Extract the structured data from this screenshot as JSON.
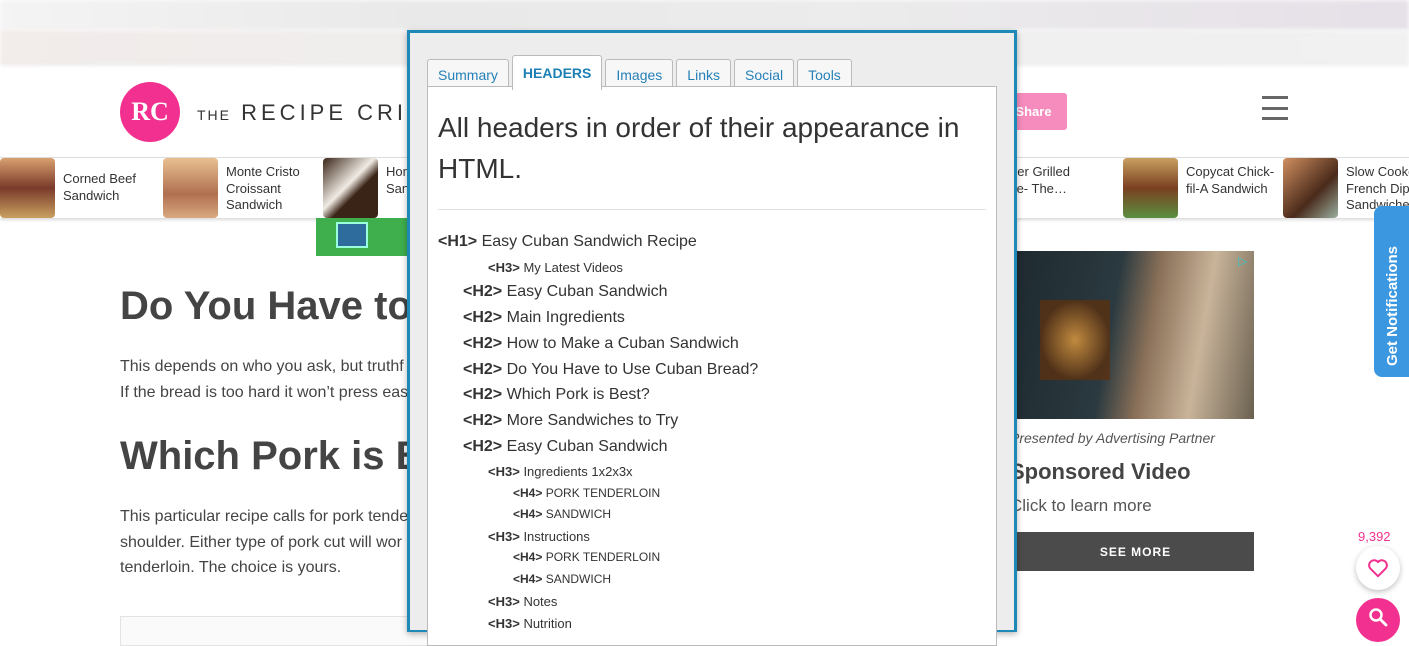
{
  "site": {
    "logo_text": "RC",
    "brand": "THE RECIPE CRITIC",
    "brand_the": "THE",
    "brand_name": "RECIPE CRITIC",
    "brand_sep": "/",
    "share_label": "Share",
    "accent": "#f2308f"
  },
  "related": [
    {
      "title": "Corned Beef Sandwich"
    },
    {
      "title": "Monte Cristo Croissant Sandwich"
    },
    {
      "title": "Hom… Ice … San…"
    },
    {
      "title": "Air Fryer Grilled Cheese- The…"
    },
    {
      "title": "Copycat Chick-fil-A Sandwich"
    },
    {
      "title": "Slow Cooker French Dip Sandwiches"
    }
  ],
  "article": {
    "h2_1": "Do You Have to Use Cuban Bread?",
    "p1_l1": "This depends on who you ask, but truthf",
    "p1_l2": "If the bread is too hard it won’t press eas",
    "h2_2": "Which Pork is Best?",
    "p2_l1": "This particular recipe calls for pork tende",
    "p2_l2": "shoulder. Either type of pork cut will wor",
    "p2_l3": "tenderloin. The choice is yours."
  },
  "sidebar_ad": {
    "partner": "Presented by Advertising Partner",
    "title": "Sponsored Video",
    "learn": "Click to learn more",
    "see_more": "SEE MORE"
  },
  "notifications_label": "Get Notifications",
  "favorites_count": "9,392",
  "panel": {
    "tabs": [
      {
        "label": "Summary",
        "active": false
      },
      {
        "label": "HEADERS",
        "active": true
      },
      {
        "label": "Images",
        "active": false
      },
      {
        "label": "Links",
        "active": false
      },
      {
        "label": "Social",
        "active": false
      },
      {
        "label": "Tools",
        "active": false
      }
    ],
    "title": "All headers in order of their appearance in HTML.",
    "headers": [
      {
        "tag": "<H1>",
        "level": 1,
        "text": "Easy Cuban Sandwich Recipe"
      },
      {
        "tag": "<H3>",
        "level": 3,
        "text": "My Latest Videos"
      },
      {
        "tag": "<H2>",
        "level": 2,
        "text": "Easy Cuban Sandwich"
      },
      {
        "tag": "<H2>",
        "level": 2,
        "text": "Main Ingredients"
      },
      {
        "tag": "<H2>",
        "level": 2,
        "text": "How to Make a Cuban Sandwich"
      },
      {
        "tag": "<H2>",
        "level": 2,
        "text": "Do You Have to Use Cuban Bread?"
      },
      {
        "tag": "<H2>",
        "level": 2,
        "text": "Which Pork is Best?"
      },
      {
        "tag": "<H2>",
        "level": 2,
        "text": "More Sandwiches to Try"
      },
      {
        "tag": "<H2>",
        "level": 2,
        "text": "Easy Cuban Sandwich"
      },
      {
        "tag": "<H3>",
        "level": 3,
        "text": "Ingredients  1x2x3x"
      },
      {
        "tag": "<H4>",
        "level": 4,
        "text": "PORK TENDERLOIN"
      },
      {
        "tag": "<H4>",
        "level": 4,
        "text": "SANDWICH"
      },
      {
        "tag": "<H3>",
        "level": 3,
        "text": "Instructions"
      },
      {
        "tag": "<H4>",
        "level": 4,
        "text": "PORK TENDERLOIN"
      },
      {
        "tag": "<H4>",
        "level": 4,
        "text": "SANDWICH"
      },
      {
        "tag": "<H3>",
        "level": 3,
        "text": "Notes"
      },
      {
        "tag": "<H3>",
        "level": 3,
        "text": "Nutrition"
      }
    ]
  }
}
